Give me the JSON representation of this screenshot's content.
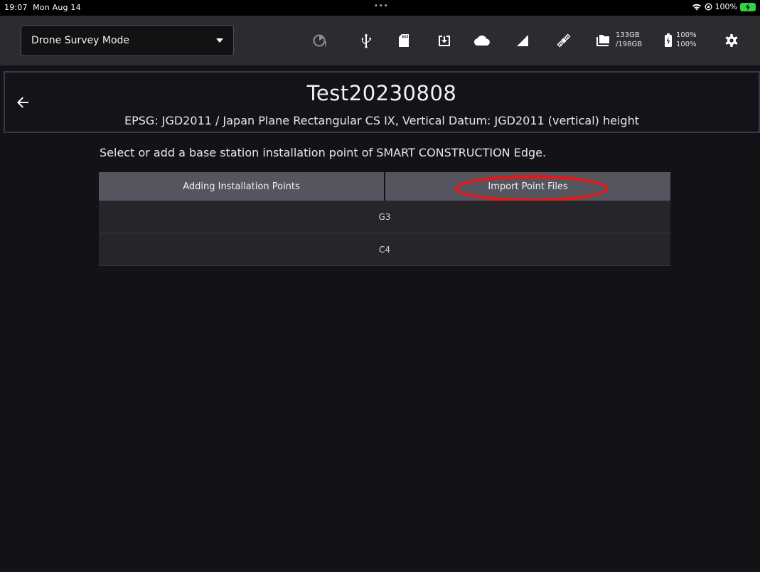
{
  "status_bar": {
    "time": "19:07",
    "date": "Mon Aug 14",
    "dots": "•••",
    "battery": "100%"
  },
  "toolbar": {
    "mode_label": "Drone Survey Mode",
    "storage_used": "133GB",
    "storage_total": "/198GB",
    "battery_1": "100%",
    "battery_2": "100%"
  },
  "header": {
    "title": "Test20230808",
    "subtitle": "EPSG: JGD2011 / Japan Plane Rectangular CS IX, Vertical Datum: JGD2011 (vertical) height"
  },
  "instruction": "Select or add a base station installation point of SMART CONSTRUCTION Edge.",
  "tabs": [
    {
      "label": "Adding Installation Points"
    },
    {
      "label": "Import Point Files"
    }
  ],
  "points": [
    {
      "name": "G3"
    },
    {
      "name": "C4"
    }
  ],
  "colors": {
    "background": "#131217",
    "toolbar": "#2b2b30",
    "tab": "#55555f",
    "row": "#25252a",
    "highlight": "#e11a1a",
    "battery_green": "#33d24d"
  }
}
